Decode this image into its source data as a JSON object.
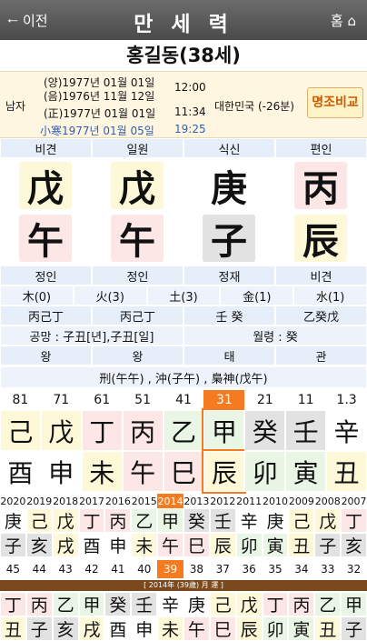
{
  "header": {
    "back": "이전",
    "title": "만 세 력",
    "home": "홈"
  },
  "name": "홍길동(38세)",
  "info": {
    "gender": "남자",
    "solar": "(양)1977년 01월 01일",
    "lunar": "(음)1976년 11월 12일",
    "time1": "12:00",
    "jeong": "(正)1977년 01월 01일",
    "time2": "11:34",
    "term": "小寒1977년 01월 05일",
    "time3": "19:25",
    "country": "대한민국 (-26분)",
    "compare": "명조비교"
  },
  "top_labels": [
    "비견",
    "일원",
    "식신",
    "편인"
  ],
  "stems": [
    "戊",
    "戊",
    "庚",
    "丙"
  ],
  "branches": [
    "午",
    "午",
    "子",
    "辰"
  ],
  "bottom_labels": [
    "정인",
    "정인",
    "정재",
    "비견"
  ],
  "elements": [
    "木(0)",
    "火(3)",
    "土(3)",
    "金(1)",
    "水(1)"
  ],
  "hidden": [
    "丙己丁",
    "丙己丁",
    "壬 癸",
    "乙癸戊"
  ],
  "gongmang": "공망 : 子丑[년],子丑[일]",
  "wolryeong": "월령 : 癸",
  "stages": [
    "왕",
    "왕",
    "태",
    "관"
  ],
  "relations": "刑(午午) , 沖(子午) , 梟神(戊午)",
  "daeun": {
    "ages": [
      "81",
      "71",
      "61",
      "51",
      "41",
      "31",
      "21",
      "11",
      "1.3"
    ],
    "stems": [
      "己",
      "戊",
      "丁",
      "丙",
      "乙",
      "甲",
      "癸",
      "壬",
      "辛"
    ],
    "branches": [
      "酉",
      "申",
      "未",
      "午",
      "巳",
      "辰",
      "卯",
      "寅",
      "丑"
    ],
    "active": 5
  },
  "yearly": {
    "years": [
      "2020",
      "2019",
      "2018",
      "2017",
      "2016",
      "2015",
      "2014",
      "2013",
      "2012",
      "2011",
      "2010",
      "2009",
      "2008",
      "2007"
    ],
    "stems": [
      "庚",
      "己",
      "戊",
      "丁",
      "丙",
      "乙",
      "甲",
      "癸",
      "壬",
      "辛",
      "庚",
      "己",
      "戊",
      "丁"
    ],
    "branches": [
      "子",
      "亥",
      "戌",
      "酉",
      "申",
      "未",
      "午",
      "巳",
      "辰",
      "卯",
      "寅",
      "丑",
      "子",
      "亥"
    ],
    "ages": [
      "45",
      "44",
      "43",
      "42",
      "41",
      "40",
      "39",
      "38",
      "37",
      "36",
      "35",
      "34",
      "33",
      "32"
    ],
    "active": 6
  },
  "monthly": {
    "label": "[ 2014年 (39歲) 月 運 ]",
    "stems": [
      "丁",
      "丙",
      "乙",
      "甲",
      "癸",
      "壬",
      "辛",
      "庚",
      "己",
      "戊",
      "丁",
      "丙",
      "乙",
      "甲"
    ],
    "branches": [
      "丑",
      "子",
      "亥",
      "戌",
      "酉",
      "申",
      "未",
      "午",
      "巳",
      "辰",
      "卯",
      "寅",
      "丑",
      "子"
    ]
  },
  "colors": {
    "green": "#e9f6e6",
    "yellow": "#fdf9d8",
    "pink": "#fde6e6",
    "gray": "#e2e2e2",
    "blue": "#e6eefa",
    "active": "#f47b20"
  }
}
